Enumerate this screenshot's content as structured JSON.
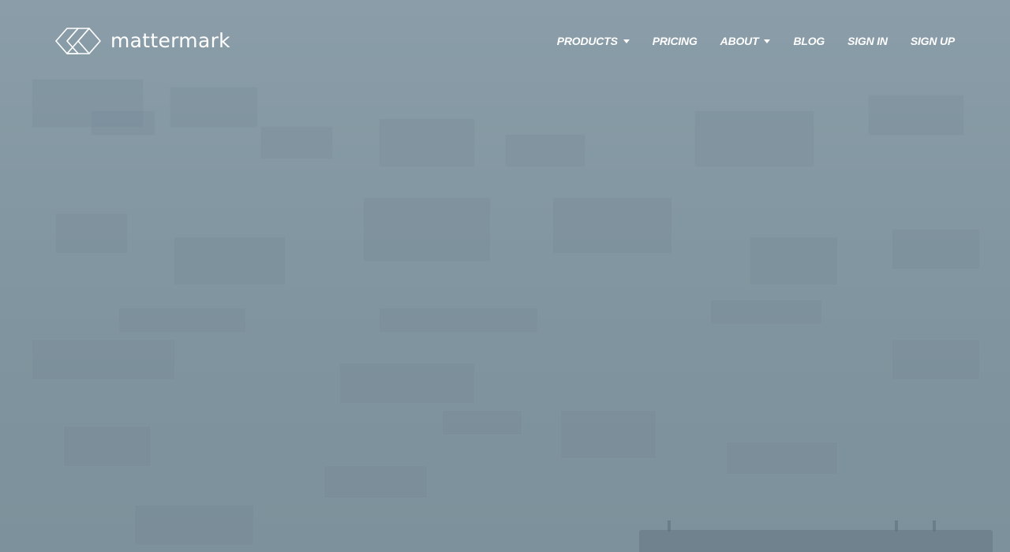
{
  "brand": {
    "name": "mattermark",
    "logo_icon": "mattermark-diamond-logo-icon"
  },
  "nav": {
    "items": [
      {
        "label": "PRODUCTS",
        "has_dropdown": true
      },
      {
        "label": "PRICING",
        "has_dropdown": false
      },
      {
        "label": "ABOUT",
        "has_dropdown": true
      },
      {
        "label": "BLOG",
        "has_dropdown": false
      },
      {
        "label": "SIGN IN",
        "has_dropdown": false
      },
      {
        "label": "SIGN UP",
        "has_dropdown": false
      }
    ],
    "dropdown_icon": "caret-down-icon"
  },
  "colors": {
    "background": "#8397a2",
    "nav_text": "#ffffff"
  }
}
